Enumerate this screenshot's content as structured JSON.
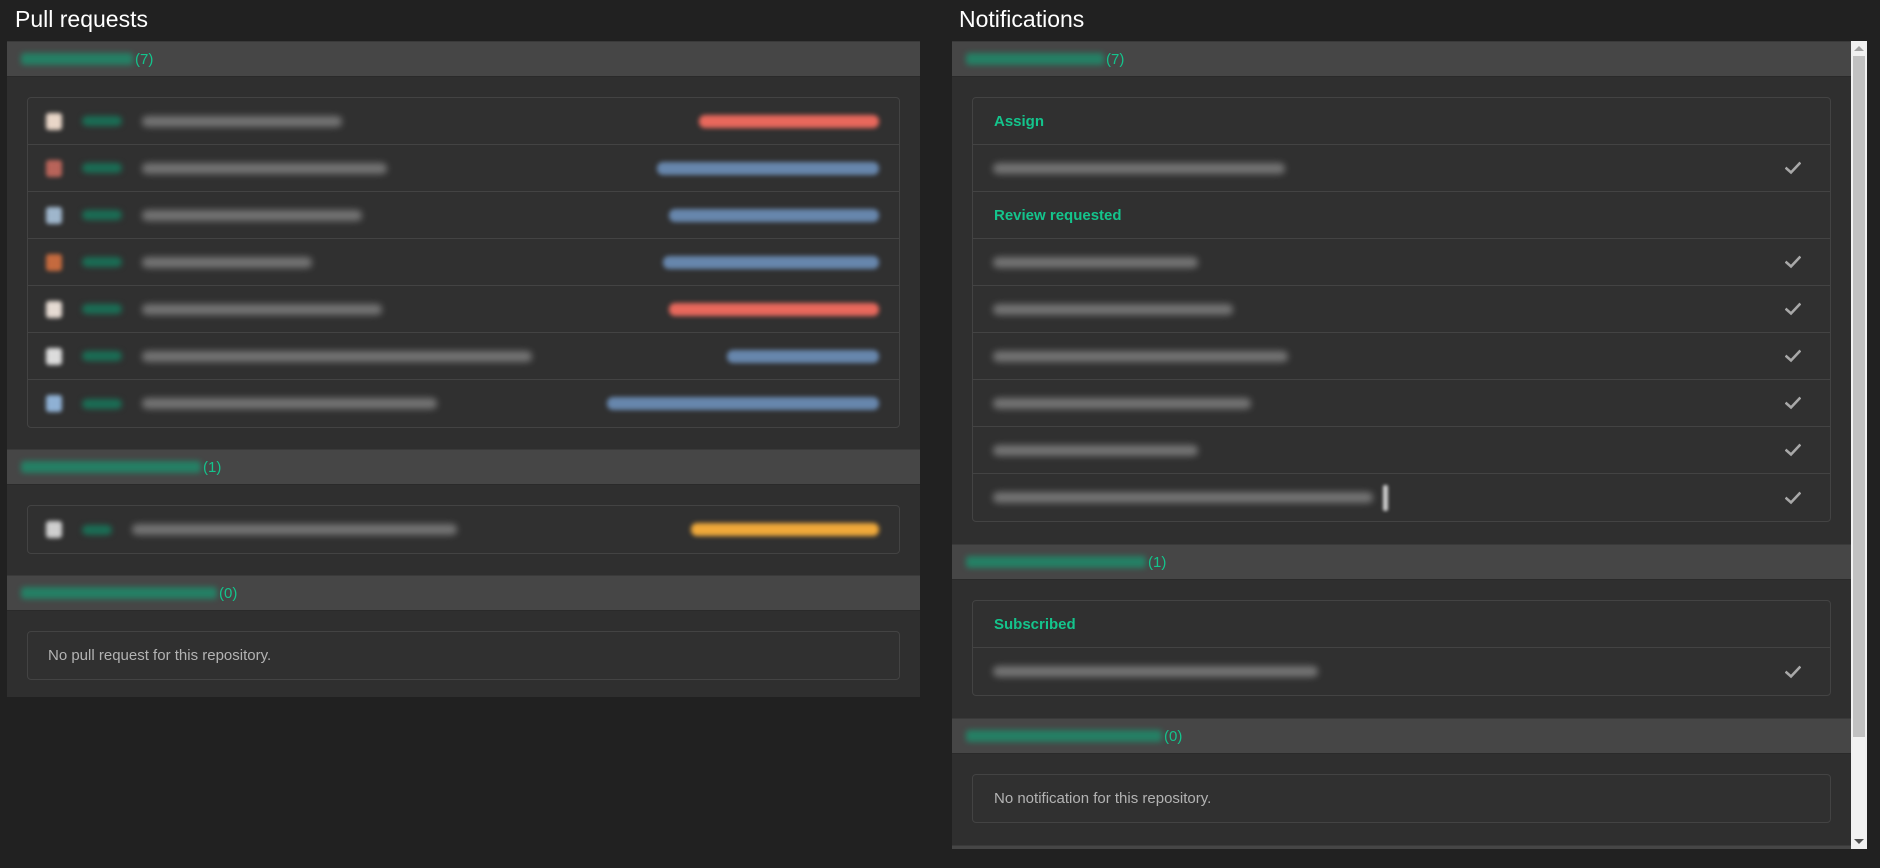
{
  "pull_requests": {
    "title": "Pull requests",
    "groups": [
      {
        "repo_name": "[redacted repository]",
        "count": "(7)",
        "items": [
          {
            "avatar_color": "#e9d6c8",
            "label_color": "#e8685c",
            "label_width": 180,
            "title_width": 200
          },
          {
            "avatar_color": "#b8645a",
            "label_color": "#6786ac",
            "label_width": 222,
            "title_width": 245
          },
          {
            "avatar_color": "#9fb6cc",
            "label_color": "#6786ac",
            "label_width": 210,
            "title_width": 220
          },
          {
            "avatar_color": "#c56a3e",
            "label_color": "#6786ac",
            "label_width": 216,
            "title_width": 170
          },
          {
            "avatar_color": "#e6dbd3",
            "label_color": "#e8685c",
            "label_width": 210,
            "title_width": 240
          },
          {
            "avatar_color": "#dcdcdc",
            "label_color": "#6786ac",
            "label_width": 152,
            "title_width": 390
          },
          {
            "avatar_color": "#8fb1d4",
            "label_color": "#6786ac",
            "label_width": 272,
            "title_width": 295
          }
        ]
      },
      {
        "repo_name": "[redacted repository]",
        "count": "(1)",
        "items": [
          {
            "avatar_color": "#cfcfcf",
            "label_color": "#f0a93a",
            "label_width": 188,
            "title_width": 325
          }
        ]
      },
      {
        "repo_name": "[redacted repository]",
        "count": "(0)",
        "empty_message": "No pull request for this repository."
      }
    ]
  },
  "notifications": {
    "title": "Notifications",
    "groups": [
      {
        "repo_name": "[redacted repository]",
        "count": "(7)",
        "sections": [
          {
            "title": "Assign",
            "items": [
              {
                "title_width": 292
              }
            ]
          },
          {
            "title": "Review requested",
            "items": [
              {
                "title_width": 205
              },
              {
                "title_width": 240
              },
              {
                "title_width": 295
              },
              {
                "title_width": 258
              },
              {
                "title_width": 205
              },
              {
                "title_width": 380,
                "cursor": true
              }
            ]
          }
        ]
      },
      {
        "repo_name": "[redacted repository]",
        "count": "(1)",
        "sections": [
          {
            "title": "Subscribed",
            "items": [
              {
                "title_width": 325
              }
            ]
          }
        ]
      },
      {
        "repo_name": "[redacted repository]",
        "count": "(0)",
        "empty_message": "No notification for this repository."
      }
    ]
  },
  "colors": {
    "accent": "#14c48c",
    "background": "#212121",
    "panel": "#2f2f2f",
    "group_header": "#464646"
  },
  "icons": {
    "mark_read": "check-icon"
  }
}
